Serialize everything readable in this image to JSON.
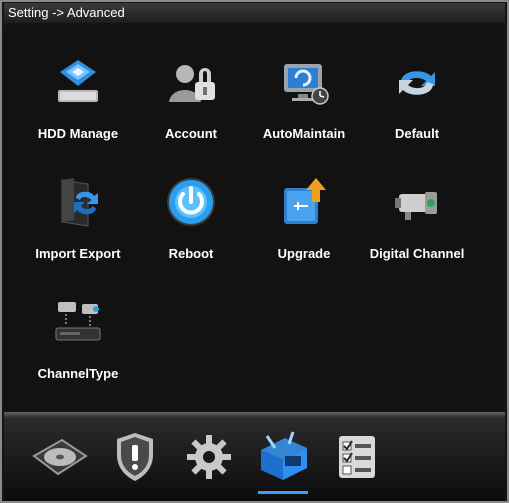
{
  "window": {
    "title": "Setting -> Advanced"
  },
  "items": [
    {
      "label": "HDD Manage",
      "icon": "hdd-manage-icon"
    },
    {
      "label": "Account",
      "icon": "account-icon"
    },
    {
      "label": "AutoMaintain",
      "icon": "automaintain-icon"
    },
    {
      "label": "Default",
      "icon": "default-icon"
    },
    {
      "label": "Import Export",
      "icon": "import-export-icon"
    },
    {
      "label": "Reboot",
      "icon": "reboot-icon"
    },
    {
      "label": "Upgrade",
      "icon": "upgrade-icon"
    },
    {
      "label": "Digital Channel",
      "icon": "digital-channel-icon"
    },
    {
      "label": "ChannelType",
      "icon": "channel-type-icon"
    }
  ],
  "bottom_tabs": [
    {
      "icon": "disk-icon",
      "active": false
    },
    {
      "icon": "alarm-shield-icon",
      "active": false
    },
    {
      "icon": "gear-icon",
      "active": false
    },
    {
      "icon": "advanced-icon",
      "active": true
    },
    {
      "icon": "info-checklist-icon",
      "active": false
    }
  ],
  "colors": {
    "window_bg": "#121212",
    "border": "#8a8a8a",
    "accent": "#3aa0ff",
    "text": "#ffffff"
  }
}
